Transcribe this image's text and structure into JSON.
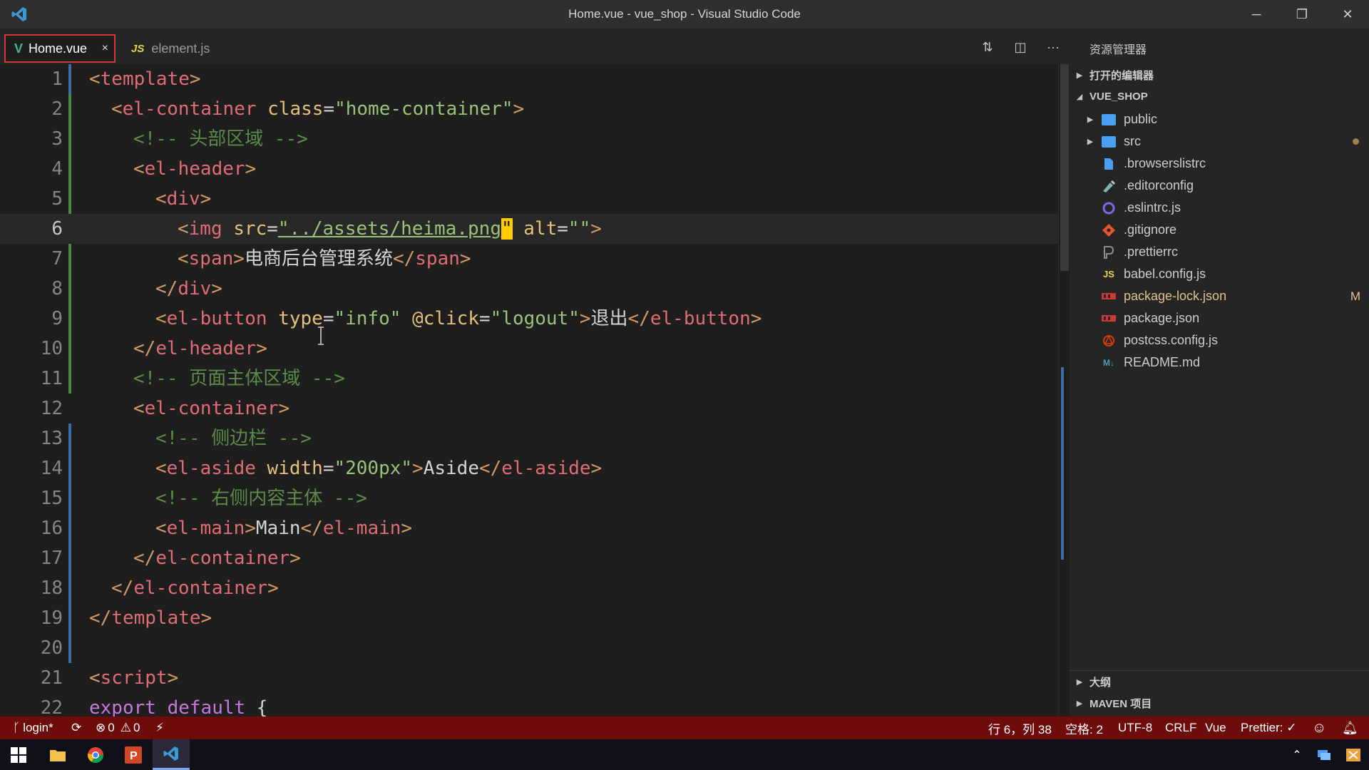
{
  "window": {
    "title": "Home.vue - vue_shop - Visual Studio Code",
    "minimize": "─",
    "restore": "❐",
    "close": "✕"
  },
  "tabs": [
    {
      "icon": "V",
      "label": "Home.vue",
      "close": "×",
      "active": true
    },
    {
      "icon": "JS",
      "label": "element.js",
      "active": false
    }
  ],
  "editor_actions": {
    "compare": "⇅",
    "split": "◫",
    "more": "···"
  },
  "editor": {
    "lines": [
      {
        "n": "1"
      },
      {
        "n": "2"
      },
      {
        "n": "3"
      },
      {
        "n": "4"
      },
      {
        "n": "5"
      },
      {
        "n": "6"
      },
      {
        "n": "7"
      },
      {
        "n": "8"
      },
      {
        "n": "9"
      },
      {
        "n": "10"
      },
      {
        "n": "11"
      },
      {
        "n": "12"
      },
      {
        "n": "13"
      },
      {
        "n": "14"
      },
      {
        "n": "15"
      },
      {
        "n": "16"
      },
      {
        "n": "17"
      },
      {
        "n": "18"
      },
      {
        "n": "19"
      },
      {
        "n": "20"
      },
      {
        "n": "21"
      },
      {
        "n": "22"
      }
    ],
    "current_line": 6,
    "code": {
      "l1": {
        "t1": "<",
        "tag": "template",
        "t2": ">"
      },
      "l2": {
        "t1": "<",
        "tag": "el-container",
        "attr": " class",
        "eq": "=",
        "val": "\"home-container\"",
        "t2": ">"
      },
      "l3": {
        "comment": "<!-- 头部区域 -->"
      },
      "l4": {
        "t1": "<",
        "tag": "el-header",
        "t2": ">"
      },
      "l5": {
        "t1": "<",
        "tag": "div",
        "t2": ">"
      },
      "l6": {
        "t1": "<",
        "tag": "img",
        "attr1": " src",
        "eq1": "=",
        "val1a": "\"../assets/heima.png",
        "val1b": "\"",
        "attr2": " alt",
        "eq2": "=",
        "val2": "\"\"",
        "t2": ">"
      },
      "l7": {
        "t1": "<",
        "tag": "span",
        "t2": ">",
        "text": "电商后台管理系统",
        "t3": "</",
        "tag2": "span",
        "t4": ">"
      },
      "l8": {
        "t1": "</",
        "tag": "div",
        "t2": ">"
      },
      "l9": {
        "t1": "<",
        "tag": "el-button",
        "attr1": " type",
        "eq1": "=",
        "val1": "\"info\"",
        "attr2": " @click",
        "eq2": "=",
        "val2": "\"logout\"",
        "t2": ">",
        "text": "退出",
        "t3": "</",
        "tag2": "el-button",
        "t4": ">"
      },
      "l10": {
        "t1": "</",
        "tag": "el-header",
        "t2": ">"
      },
      "l11": {
        "comment": "<!-- 页面主体区域 -->"
      },
      "l12": {
        "t1": "<",
        "tag": "el-container",
        "t2": ">"
      },
      "l13": {
        "comment": "<!-- 侧边栏 -->"
      },
      "l14": {
        "t1": "<",
        "tag": "el-aside",
        "attr": " width",
        "eq": "=",
        "val": "\"200px\"",
        "t2": ">",
        "text": "Aside",
        "t3": "</",
        "tag2": "el-aside",
        "t4": ">"
      },
      "l15": {
        "comment": "<!-- 右侧内容主体 -->"
      },
      "l16": {
        "t1": "<",
        "tag": "el-main",
        "t2": ">",
        "text": "Main",
        "t3": "</",
        "tag2": "el-main",
        "t4": ">"
      },
      "l17": {
        "t1": "</",
        "tag": "el-container",
        "t2": ">"
      },
      "l18": {
        "t1": "</",
        "tag": "el-container",
        "t2": ">"
      },
      "l19": {
        "t1": "</",
        "tag": "template",
        "t2": ">"
      },
      "l21": {
        "t1": "<",
        "tag": "script",
        "t2": ">"
      },
      "l22": {
        "kw1": "export",
        "kw2": " default",
        "tx": " {"
      }
    }
  },
  "sidebar": {
    "title": "资源管理器",
    "sections": {
      "open_editors": "打开的编辑器",
      "project": "VUE_SHOP",
      "outline": "大纲",
      "maven": "MAVEN 项目"
    },
    "files": [
      {
        "name": "public",
        "icon": "folder-icon"
      },
      {
        "name": "src",
        "icon": "folder-icon"
      },
      {
        "name": ".browserslistrc",
        "icon": "file-icon"
      },
      {
        "name": ".editorconfig",
        "icon": "editorconfig-icon"
      },
      {
        "name": ".eslintrc.js",
        "icon": "eslint-icon"
      },
      {
        "name": ".gitignore",
        "icon": "git-icon"
      },
      {
        "name": ".prettierrc",
        "icon": "prettier-icon"
      },
      {
        "name": "babel.config.js",
        "icon": "js-icon",
        "glyph": "JS"
      },
      {
        "name": "package-lock.json",
        "icon": "npm-icon",
        "status": "M"
      },
      {
        "name": "package.json",
        "icon": "npm-icon"
      },
      {
        "name": "postcss.config.js",
        "icon": "postcss-icon"
      },
      {
        "name": "README.md",
        "icon": "markdown-icon",
        "glyph": "M↓"
      }
    ]
  },
  "status": {
    "branch": "login*",
    "errors": "0",
    "warnings": "0",
    "position": "行 6，列 38",
    "spaces": "空格: 2",
    "encoding": "UTF-8",
    "eol": "CRLF",
    "language": "Vue",
    "formatter": "Prettier: ✓"
  },
  "colors": {
    "statusbar": "#6e0c0c",
    "active_tab_border": "#d13a3a",
    "vue_green": "#41b883",
    "folder_blue": "#4a9ff5"
  }
}
